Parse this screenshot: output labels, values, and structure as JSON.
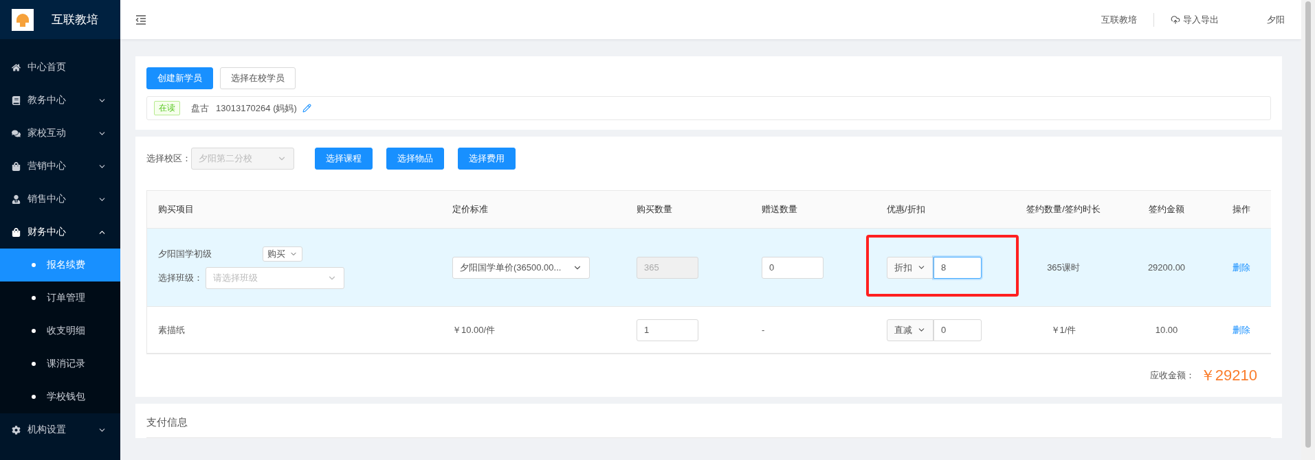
{
  "sidebar": {
    "logo_text": "互联教培",
    "items": [
      {
        "kind": "link",
        "label": "中心首页"
      },
      {
        "kind": "group",
        "label": "教务中心",
        "expanded": false
      },
      {
        "kind": "group",
        "label": "家校互动",
        "expanded": false
      },
      {
        "kind": "group",
        "label": "营销中心",
        "expanded": false
      },
      {
        "kind": "group",
        "label": "销售中心",
        "expanded": false
      },
      {
        "kind": "group",
        "label": "财务中心",
        "expanded": true,
        "children": [
          {
            "label": "报名续费",
            "selected": true
          },
          {
            "label": "订单管理",
            "selected": false
          },
          {
            "label": "收支明细",
            "selected": false
          },
          {
            "label": "课消记录",
            "selected": false
          },
          {
            "label": "学校钱包",
            "selected": false
          }
        ]
      },
      {
        "kind": "group",
        "label": "机构设置",
        "expanded": false
      }
    ]
  },
  "header": {
    "org": "互联教培",
    "import_export": "导入导出",
    "user": "夕阳"
  },
  "student_card": {
    "buttons": [
      {
        "label": "创建新学员",
        "primary": true
      },
      {
        "label": "选择在校学员",
        "primary": false
      }
    ],
    "student": {
      "status": "在读",
      "name": "盘古",
      "phone": "13013170264 (妈妈)"
    }
  },
  "order": {
    "campus_label": "选择校区：",
    "campus": "夕阳第二分校",
    "buttons": [
      "选择课程",
      "选择物品",
      "选择费用"
    ],
    "columns": [
      "购买项目",
      "定价标准",
      "购买数量",
      "赠送数量",
      "优惠/折扣",
      "签约数量/签约时长",
      "签约金额",
      "操作"
    ],
    "rows": [
      {
        "kind": "course",
        "selected": true,
        "name": "夕阳国学初级",
        "type": "购买",
        "class_label": "选择班级：",
        "class_placeholder": "请选择班级",
        "price": "夕阳国学单价(36500.00...",
        "quantity": "365",
        "gift": "0",
        "discount_type": "折扣",
        "discount_value": "8",
        "discount_focused": true,
        "highlighted": true,
        "contract": "365课时",
        "amount": "29200.00",
        "action": "删除"
      },
      {
        "kind": "goods",
        "selected": false,
        "name": "素描纸",
        "price": "￥10.00/件",
        "quantity": "1",
        "gift": "-",
        "discount_type": "直减",
        "discount_value": "0",
        "discount_focused": false,
        "highlighted": false,
        "contract": "￥1/件",
        "amount": "10.00",
        "action": "删除"
      }
    ],
    "total_label": "应收金额：",
    "total": "￥29210"
  },
  "payment": {
    "title": "支付信息"
  }
}
